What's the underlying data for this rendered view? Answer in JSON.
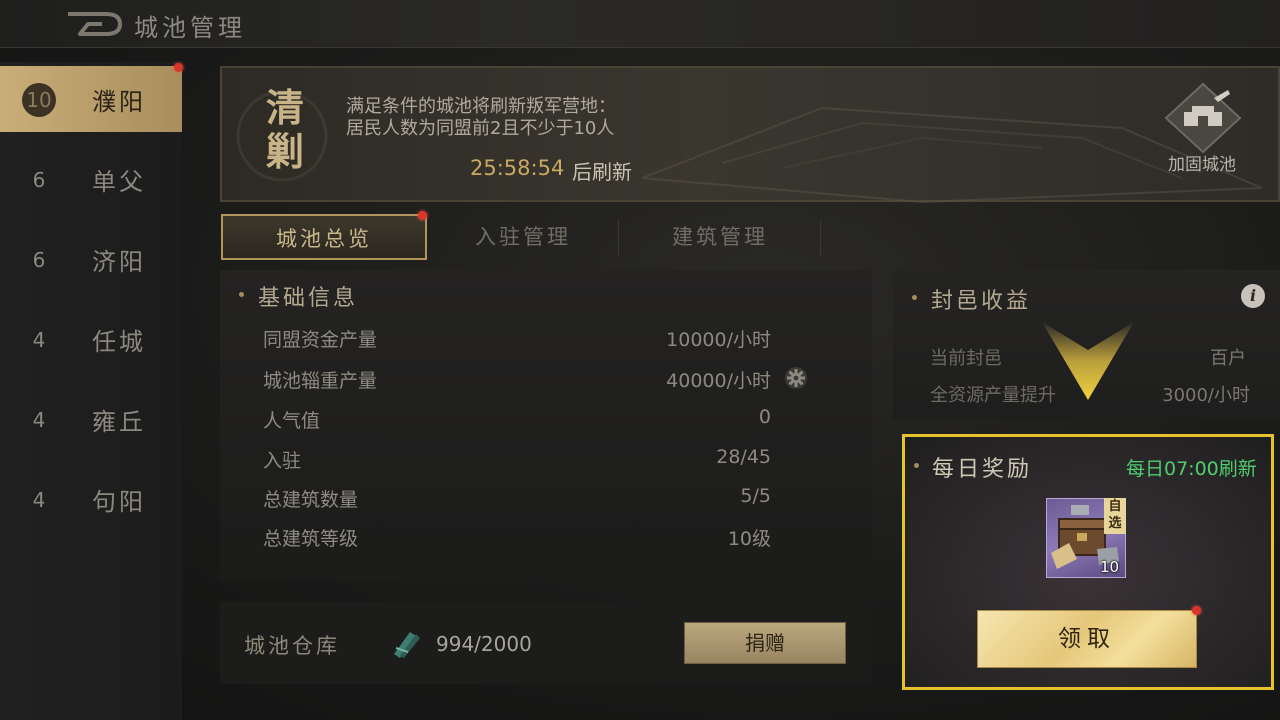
{
  "header": {
    "title": "城池管理"
  },
  "sidebar": {
    "items": [
      {
        "level": "10",
        "name": "濮阳",
        "active": true
      },
      {
        "level": "6",
        "name": "单父",
        "active": false
      },
      {
        "level": "6",
        "name": "济阳",
        "active": false
      },
      {
        "level": "4",
        "name": "任城",
        "active": false
      },
      {
        "level": "4",
        "name": "雍丘",
        "active": false
      },
      {
        "level": "4",
        "name": "句阳",
        "active": false
      }
    ]
  },
  "banner": {
    "seal_text": "清剿",
    "line1": "满足条件的城池将刷新叛军营地：",
    "line2": "居民人数为同盟前2且不少于10人",
    "timer": "25:58:54",
    "timer_suffix": "后刷新",
    "fortify_label": "加固城池"
  },
  "tabs": [
    {
      "label": "城池总览",
      "active": true
    },
    {
      "label": "入驻管理",
      "active": false
    },
    {
      "label": "建筑管理",
      "active": false
    }
  ],
  "basic_info": {
    "title": "基础信息",
    "rows": [
      {
        "label": "同盟资金产量",
        "value": "10000/小时"
      },
      {
        "label": "城池辎重产量",
        "value": "40000/小时"
      },
      {
        "label": "人气值",
        "value": "0"
      },
      {
        "label": "入驻",
        "value": "28/45"
      },
      {
        "label": "总建筑数量",
        "value": "5/5"
      },
      {
        "label": "总建筑等级",
        "value": "10级"
      }
    ]
  },
  "warehouse": {
    "label": "城池仓库",
    "value": "994/2000",
    "donate_label": "捐赠"
  },
  "fief": {
    "title": "封邑收益",
    "rows": [
      {
        "label": "当前封邑",
        "value": "百户"
      },
      {
        "label": "全资源产量提升",
        "value": "3000/小时"
      }
    ]
  },
  "daily_reward": {
    "title": "每日奖励",
    "refresh": "每日07:00刷新",
    "item_tag": "自选",
    "item_count": "10",
    "claim_label": "领取"
  },
  "colors": {
    "accent_gold": "#b0965c",
    "highlight_yellow": "#e6c32c",
    "refresh_green": "#4fce6e",
    "notify_red": "#d8362a"
  }
}
